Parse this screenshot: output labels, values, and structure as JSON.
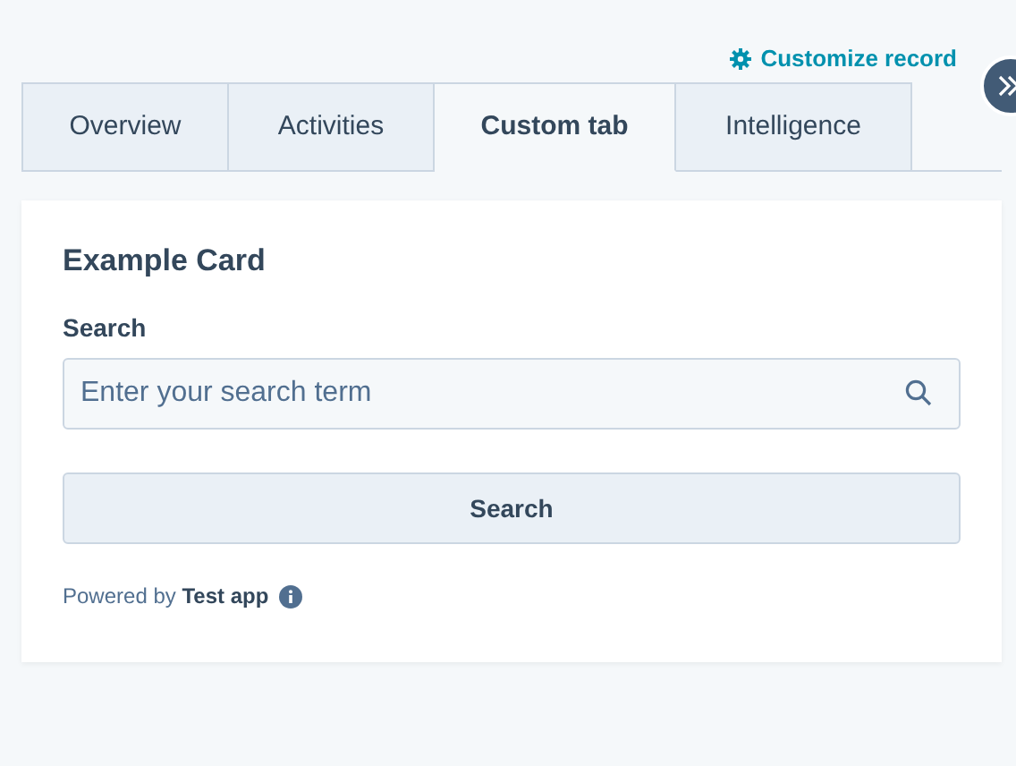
{
  "header": {
    "customize_link": "Customize record"
  },
  "tabs": [
    {
      "label": "Overview",
      "selected": false
    },
    {
      "label": "Activities",
      "selected": false
    },
    {
      "label": "Custom tab",
      "selected": true
    },
    {
      "label": "Intelligence",
      "selected": false
    }
  ],
  "card": {
    "title": "Example Card",
    "search_label": "Search",
    "search": {
      "placeholder": "Enter your search term"
    },
    "button": "Search",
    "footer": "Powered by **Test app**"
  }
}
